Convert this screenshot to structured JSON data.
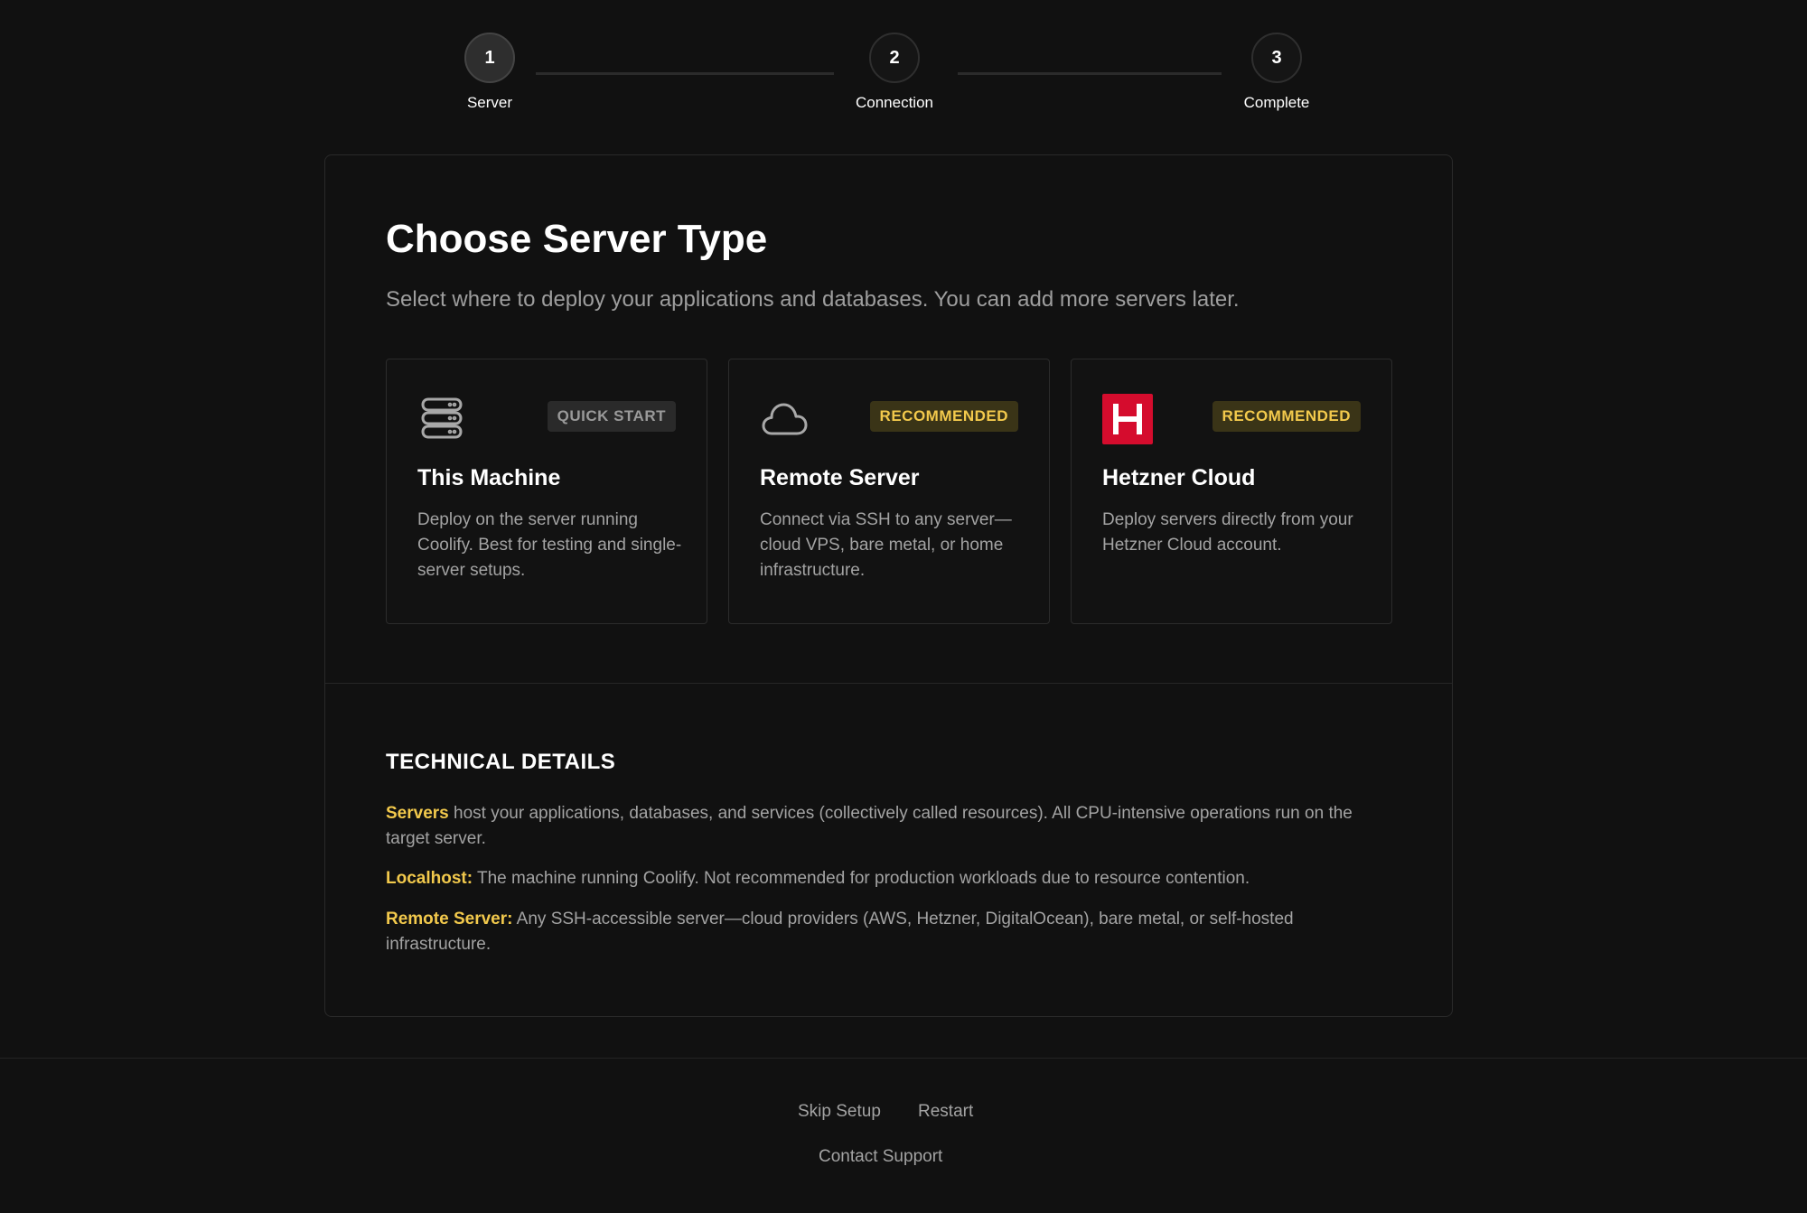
{
  "stepper": {
    "steps": [
      {
        "number": "1",
        "label": "Server",
        "state": "active"
      },
      {
        "number": "2",
        "label": "Connection",
        "state": "pending"
      },
      {
        "number": "3",
        "label": "Complete",
        "state": "pending"
      }
    ]
  },
  "main": {
    "title": "Choose Server Type",
    "subtitle": "Select where to deploy your applications and databases. You can add more servers later.",
    "options": [
      {
        "icon": "server-stack-icon",
        "badge": "QUICK START",
        "title": "This Machine",
        "description": "Deploy on the server running Coolify. Best for testing and single-server setups."
      },
      {
        "icon": "cloud-icon",
        "badge": "RECOMMENDED",
        "title": "Remote Server",
        "description": "Connect via SSH to any server—cloud VPS, bare metal, or home infrastructure."
      },
      {
        "icon": "hetzner-logo-icon",
        "logo_letter": "H",
        "badge": "RECOMMENDED",
        "title": "Hetzner Cloud",
        "description": "Deploy servers directly from your Hetzner Cloud account."
      }
    ]
  },
  "technical": {
    "heading": "TECHNICAL DETAILS",
    "items": [
      {
        "key": "Servers",
        "text": " host your applications, databases, and services (collectively called resources). All CPU-intensive operations run on the target server."
      },
      {
        "key": "Localhost:",
        "text": " The machine running Coolify. Not recommended for production workloads due to resource contention."
      },
      {
        "key": "Remote Server:",
        "text": " Any SSH-accessible server—cloud providers (AWS, Hetzner, DigitalOcean), bare metal, or self-hosted infrastructure."
      }
    ]
  },
  "footer": {
    "skip_setup": "Skip Setup",
    "restart": "Restart",
    "contact_support": "Contact Support"
  },
  "colors": {
    "background": "#111111",
    "accent_yellow": "#f2c94c",
    "hetzner_red": "#d50c2d"
  }
}
